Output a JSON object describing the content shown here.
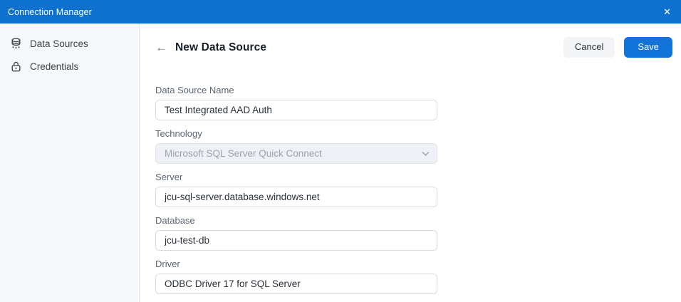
{
  "colors": {
    "titlebar_blue": "#0e71d0",
    "save_button_blue": "#1273d9",
    "sidebar_background": "#f7f8fa",
    "disabled_field_background": "#eef1f5"
  },
  "titlebar": {
    "title": "Connection Manager",
    "close": "✕"
  },
  "sidebar": {
    "items": [
      {
        "label": "Data Sources",
        "icon": "database-icon"
      },
      {
        "label": "Credentials",
        "icon": "lock-icon"
      }
    ]
  },
  "header": {
    "back": "←",
    "title": "New Data Source",
    "cancel": "Cancel",
    "save": "Save"
  },
  "form": {
    "name": {
      "label": "Data Source Name",
      "value": "Test Integrated AAD Auth"
    },
    "technology": {
      "label": "Technology",
      "value": "Microsoft SQL Server Quick Connect",
      "disabled": true
    },
    "server": {
      "label": "Server",
      "value": "jcu-sql-server.database.windows.net"
    },
    "database": {
      "label": "Database",
      "value": "jcu-test-db"
    },
    "driver": {
      "label": "Driver",
      "value": "ODBC Driver 17 for SQL Server"
    }
  }
}
